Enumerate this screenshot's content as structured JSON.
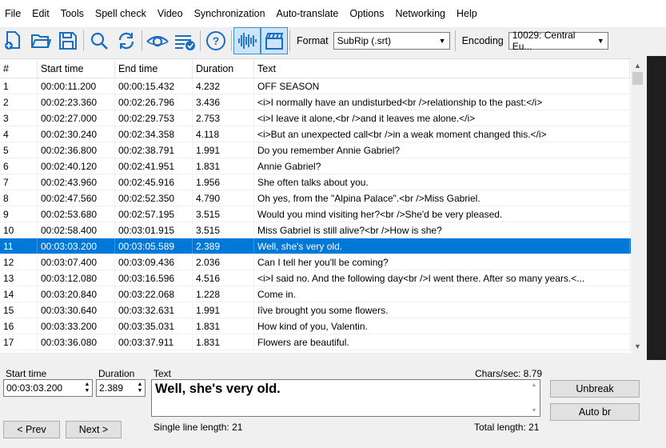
{
  "menu": [
    "File",
    "Edit",
    "Tools",
    "Spell check",
    "Video",
    "Synchronization",
    "Auto-translate",
    "Options",
    "Networking",
    "Help"
  ],
  "toolbar": {
    "format_label": "Format",
    "format_value": "SubRip (.srt)",
    "encoding_label": "Encoding",
    "encoding_value": "10029: Central Eu..."
  },
  "grid": {
    "columns": [
      "#",
      "Start time",
      "End time",
      "Duration",
      "Text"
    ],
    "selected_index": 10,
    "rows": [
      [
        "1",
        "00:00:11.200",
        "00:00:15.432",
        "4.232",
        "OFF SEASON"
      ],
      [
        "2",
        "00:02:23.360",
        "00:02:26.796",
        "3.436",
        "<i>I normally have an undisturbed<br />relationship to the past:</i>"
      ],
      [
        "3",
        "00:02:27.000",
        "00:02:29.753",
        "2.753",
        "<i>I leave it alone,<br />and it leaves me alone.</i>"
      ],
      [
        "4",
        "00:02:30.240",
        "00:02:34.358",
        "4.118",
        "<i>But an unexpected call<br />in a weak moment changed this.</i>"
      ],
      [
        "5",
        "00:02:36.800",
        "00:02:38.791",
        "1.991",
        "Do you remember Annie Gabriel?"
      ],
      [
        "6",
        "00:02:40.120",
        "00:02:41.951",
        "1.831",
        "Annie Gabriel?"
      ],
      [
        "7",
        "00:02:43.960",
        "00:02:45.916",
        "1.956",
        "She often talks about you."
      ],
      [
        "8",
        "00:02:47.560",
        "00:02:52.350",
        "4.790",
        "Oh yes, from the \"Alpina Palace\".<br />Miss Gabriel."
      ],
      [
        "9",
        "00:02:53.680",
        "00:02:57.195",
        "3.515",
        "Would you mind visiting her?<br />She'd be very pleased."
      ],
      [
        "10",
        "00:02:58.400",
        "00:03:01.915",
        "3.515",
        "Miss Gabriel is still alive?<br />How is she?"
      ],
      [
        "11",
        "00:03:03.200",
        "00:03:05.589",
        "2.389",
        "Well, she's very old."
      ],
      [
        "12",
        "00:03:07.400",
        "00:03:09.436",
        "2.036",
        "Can I tell her you'll be coming?"
      ],
      [
        "13",
        "00:03:12.080",
        "00:03:16.596",
        "4.516",
        "<i>I said no. And the following day<br />I went there. After so many years.<..."
      ],
      [
        "14",
        "00:03:20.840",
        "00:03:22.068",
        "1.228",
        "Come in."
      ],
      [
        "15",
        "00:03:30.640",
        "00:03:32.631",
        "1.991",
        "Iîve brought you some flowers."
      ],
      [
        "16",
        "00:03:33.200",
        "00:03:35.031",
        "1.831",
        "How kind of you, Valentin."
      ],
      [
        "17",
        "00:03:36.080",
        "00:03:37.911",
        "1.831",
        "Flowers are beautiful."
      ]
    ]
  },
  "edit": {
    "start_time_label": "Start time",
    "start_time_value": "00:03:03.200",
    "duration_label": "Duration",
    "duration_value": "2.389",
    "text_label": "Text",
    "chars_per_sec": "Chars/sec: 8.79",
    "text_value": "Well, she's very old.",
    "single_line_length": "Single line length: 21",
    "total_length": "Total length: 21",
    "unbreak_label": "Unbreak",
    "auto_br_label": "Auto br",
    "prev_label": "< Prev",
    "next_label": "Next >"
  }
}
